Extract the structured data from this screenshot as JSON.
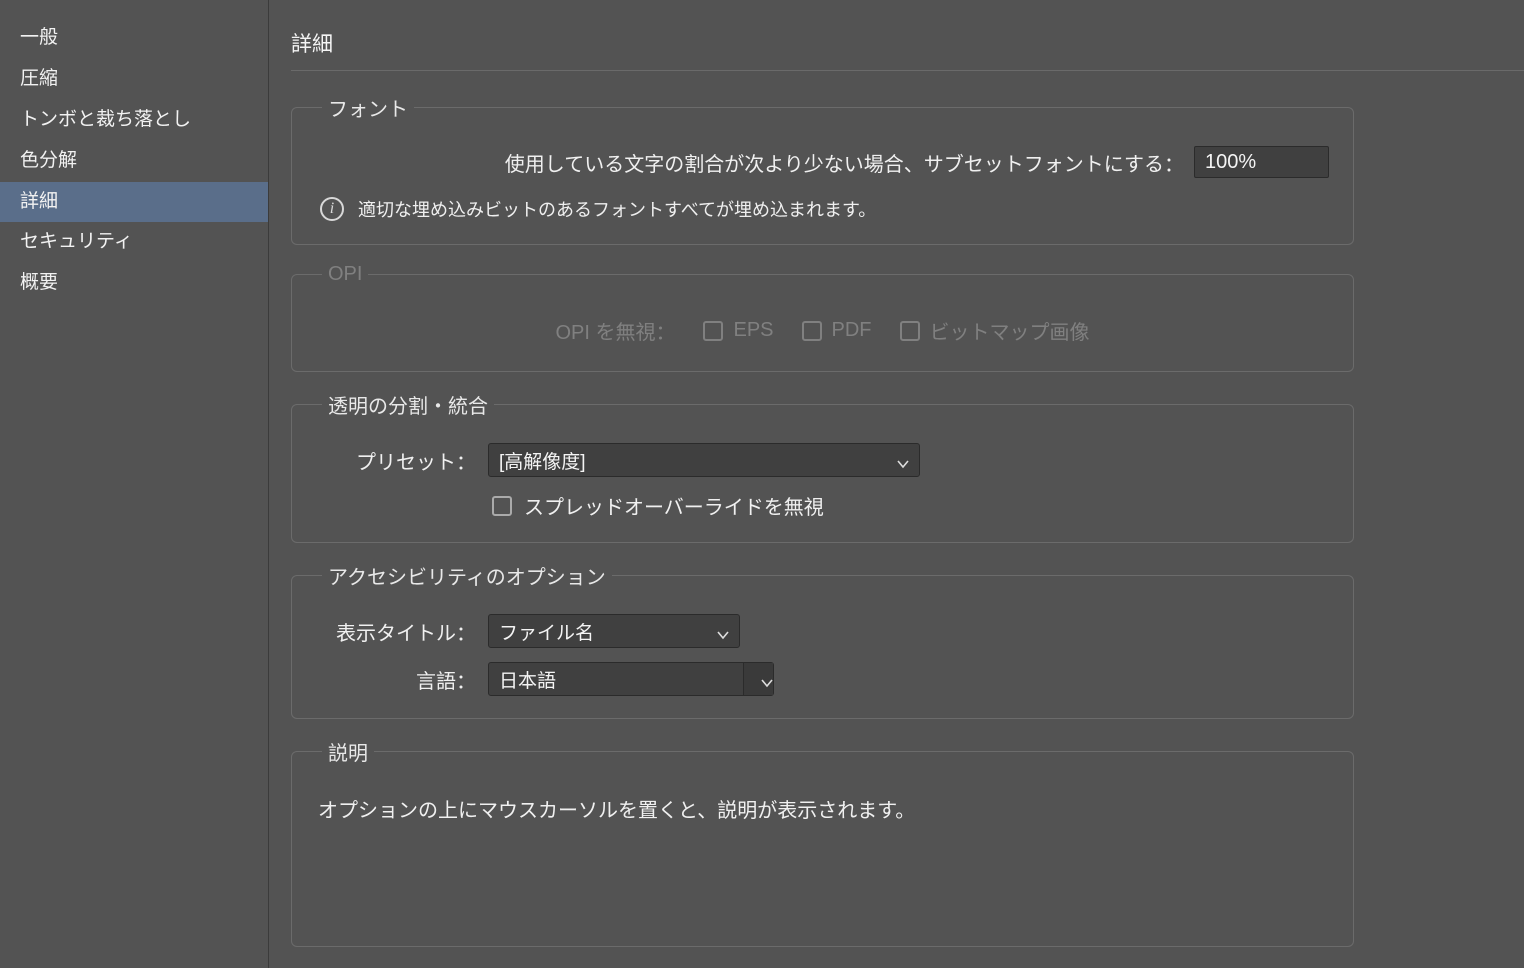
{
  "sidebar": {
    "items": [
      {
        "label": "一般"
      },
      {
        "label": "圧縮"
      },
      {
        "label": "トンボと裁ち落とし"
      },
      {
        "label": "色分解"
      },
      {
        "label": "詳細"
      },
      {
        "label": "セキュリティ"
      },
      {
        "label": "概要"
      }
    ],
    "selected_index": 4
  },
  "main": {
    "title": "詳細",
    "font": {
      "legend": "フォント",
      "subset_label": "使用している文字の割合が次より少ない場合、サブセットフォントにする：",
      "subset_value": "100%",
      "info_text": "適切な埋め込みビットのあるフォントすべてが埋め込まれます。"
    },
    "opi": {
      "legend": "OPI",
      "ignore_label": "OPI を無視：",
      "eps": "EPS",
      "pdf": "PDF",
      "bitmap": "ビットマップ画像"
    },
    "flatten": {
      "legend": "透明の分割・統合",
      "preset_label": "プリセット：",
      "preset_value": "[高解像度]",
      "override_label": "スプレッドオーバーライドを無視"
    },
    "access": {
      "legend": "アクセシビリティのオプション",
      "title_label": "表示タイトル：",
      "title_value": "ファイル名",
      "lang_label": "言語：",
      "lang_value": "日本語"
    },
    "description": {
      "legend": "説明",
      "text": "オプションの上にマウスカーソルを置くと、説明が表示されます。"
    }
  }
}
